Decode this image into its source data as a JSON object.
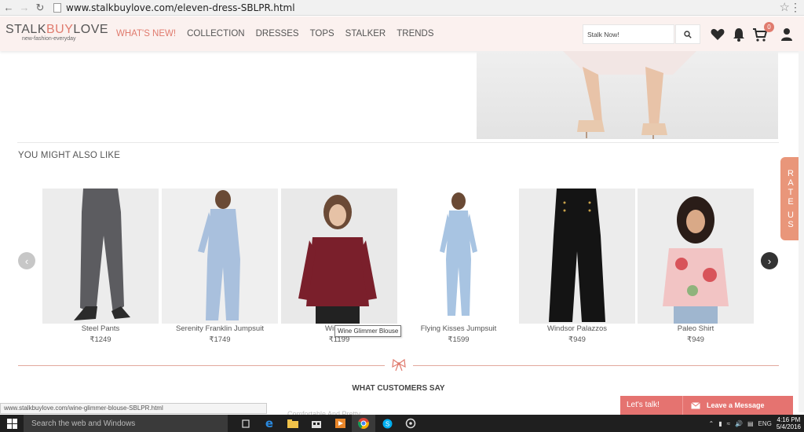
{
  "browser": {
    "url": "www.stalkbuylove.com/eleven-dress-SBLPR.html"
  },
  "header": {
    "logo_part1": "STALK",
    "logo_part2": "BUY",
    "logo_part3": "LOVE",
    "tagline": "new-fashion-everyday",
    "nav": [
      "WHAT'S NEW!",
      "COLLECTION",
      "DRESSES",
      "TOPS",
      "STALKER",
      "TRENDS"
    ],
    "search_placeholder": "Stalk Now!",
    "cart_count": "0"
  },
  "section": {
    "title": "YOU MIGHT ALSO LIKE"
  },
  "products": [
    {
      "name": "Steel Pants",
      "price": "₹1249"
    },
    {
      "name": "Serenity Franklin Jumpsuit",
      "price": "₹1749"
    },
    {
      "name": "Wine Glimmer Blouse",
      "name_shown": "Wine Gli",
      "price": "₹1199"
    },
    {
      "name": "Flying Kisses Jumpsuit",
      "price": "₹1599"
    },
    {
      "name": "Windsor Palazzos",
      "price": "₹949"
    },
    {
      "name": "Paleo Shirt",
      "price": "₹949"
    }
  ],
  "tooltip": "Wine Glimmer Blouse",
  "rate_tab": [
    "R",
    "A",
    "T",
    "E",
    "",
    "U",
    "S"
  ],
  "customers": {
    "title": "WHAT CUSTOMERS SAY",
    "faded_text": "Comfortable And Pretty"
  },
  "status_url": "www.stalkbuylove.com/wine-glimmer-blouse-SBLPR.html",
  "chat": {
    "lets_talk": "Let's talk!",
    "leave_message": "Leave a Message"
  },
  "taskbar": {
    "search_placeholder": "Search the web and Windows",
    "lang": "ENG",
    "time": "4:16 PM",
    "date": "5/4/2016"
  },
  "colors": {
    "accent": "#e07b6e",
    "header_bg": "#fbf1ef",
    "chat": "#e57370"
  }
}
